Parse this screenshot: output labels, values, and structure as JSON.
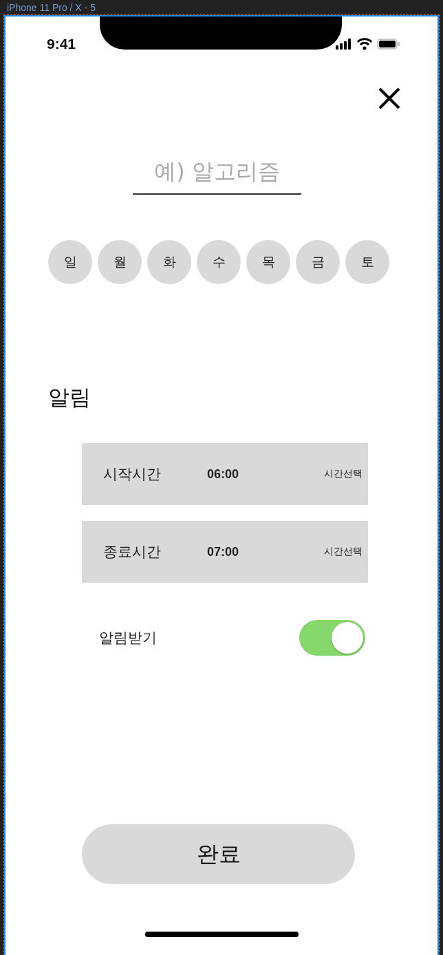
{
  "frame_label": "iPhone 11 Pro / X - 5",
  "status_bar": {
    "time": "9:41"
  },
  "title_field": {
    "placeholder": "예) 알고리즘"
  },
  "days": [
    "일",
    "월",
    "화",
    "수",
    "목",
    "금",
    "토"
  ],
  "section_title": "알림",
  "time_rows": [
    {
      "label": "시작시간",
      "value": "06:00",
      "action": "시간선택"
    },
    {
      "label": "종료시간",
      "value": "07:00",
      "action": "시간선택"
    }
  ],
  "notify": {
    "label": "알림받기",
    "on": true
  },
  "done_button": "완료"
}
